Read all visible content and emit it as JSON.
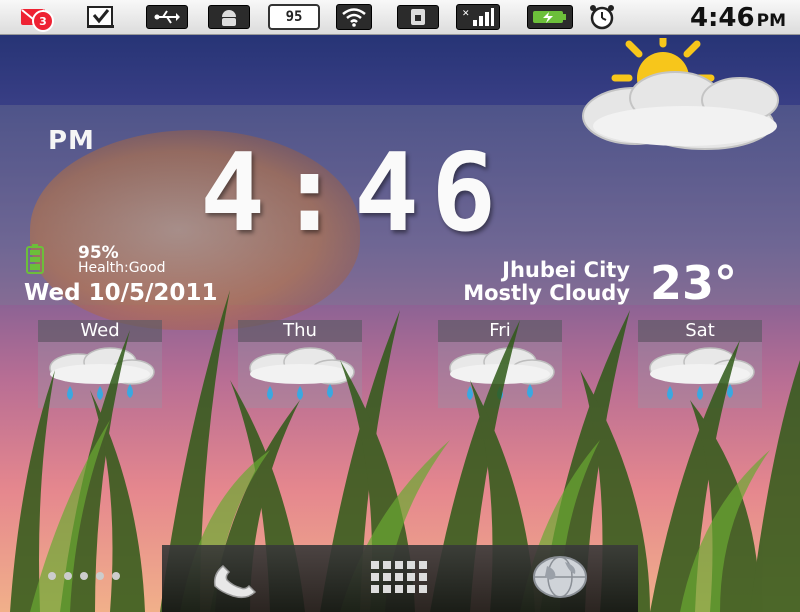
{
  "status_bar": {
    "notification_count": "3",
    "battery_level": "95",
    "time": "4:46",
    "ampm": "PM",
    "icons": [
      "gmail-icon",
      "download-complete-icon",
      "usb-icon",
      "android-debug-icon",
      "battery-level-icon",
      "wifi-icon",
      "sim-card-icon",
      "signal-bars-icon",
      "charging-battery-icon",
      "alarm-clock-icon"
    ]
  },
  "clock_widget": {
    "ampm": "PM",
    "time": "4:46",
    "battery_percent": "95%",
    "health": "Health:Good",
    "date": "Wed 10/5/2011",
    "city": "Jhubei City",
    "condition": "Mostly Cloudy",
    "temperature": "23°",
    "weather_icon": "sun-behind-cloud-icon"
  },
  "forecast": [
    {
      "day": "Wed",
      "icon": "rain-cloud-icon"
    },
    {
      "day": "Thu",
      "icon": "rain-cloud-icon"
    },
    {
      "day": "Fri",
      "icon": "rain-cloud-icon"
    },
    {
      "day": "Sat",
      "icon": "rain-cloud-icon"
    }
  ],
  "dock": {
    "icons": [
      "page-indicator-dots",
      "phone-icon",
      "app-drawer-icon",
      "browser-globe-icon"
    ]
  },
  "colors": {
    "status_bar_bg": "#e8e8e8",
    "battery_green": "#6cbf3a",
    "raindrop_blue": "#3aa8e0"
  }
}
